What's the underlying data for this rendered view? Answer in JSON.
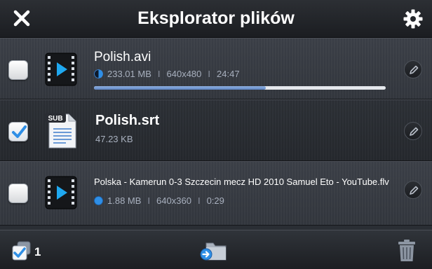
{
  "header": {
    "title": "Eksplorator plików",
    "close_icon": "close-icon",
    "settings_icon": "gear-icon"
  },
  "files": [
    {
      "name": "Polish.avi",
      "checked": false,
      "icon": "video-file-icon",
      "status_icon": "half-filled-circle-icon",
      "size": "233.01 MB",
      "resolution": "640x480",
      "duration": "24:47",
      "progress": 0.59
    },
    {
      "name": "Polish.srt",
      "checked": true,
      "icon": "subtitle-file-icon",
      "icon_badge": "SUB",
      "size": "47.23 KB"
    },
    {
      "name": "Polska - Kamerun 0-3 Szczecin mecz HD 2010 Samuel Eto - YouTube.flv",
      "checked": false,
      "icon": "video-file-icon",
      "status_icon": "blue-circle-icon",
      "size": "1.88 MB",
      "resolution": "640x360",
      "duration": "0:29"
    }
  ],
  "footer": {
    "selected_count": "1",
    "move_icon": "move-to-folder-icon",
    "delete_icon": "trash-icon"
  },
  "colors": {
    "accent_blue": "#2f8fe6",
    "meta_text": "#a8b0be",
    "header_bg": "#1f2226"
  }
}
